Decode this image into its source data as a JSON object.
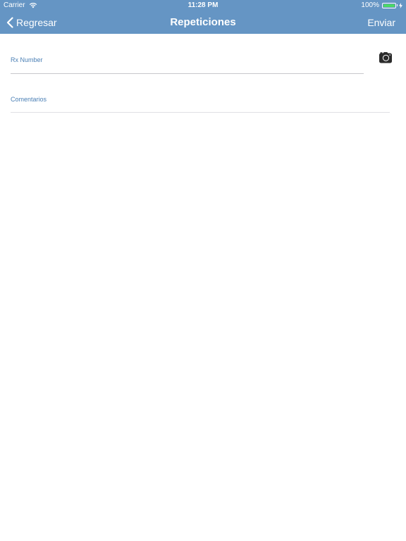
{
  "status_bar": {
    "carrier": "Carrier",
    "time": "11:28 PM",
    "battery_percent": "100%",
    "battery_level": 1.0,
    "battery_color": "#4cd964"
  },
  "nav_bar": {
    "back_label": "Regresar",
    "title": "Repeticiones",
    "send_label": "Enviar",
    "background_color": "#6595c4"
  },
  "form": {
    "rx_number": {
      "label": "Rx Number",
      "value": ""
    },
    "comments": {
      "label": "Comentarios",
      "value": ""
    },
    "camera_icon": "camera-icon"
  }
}
